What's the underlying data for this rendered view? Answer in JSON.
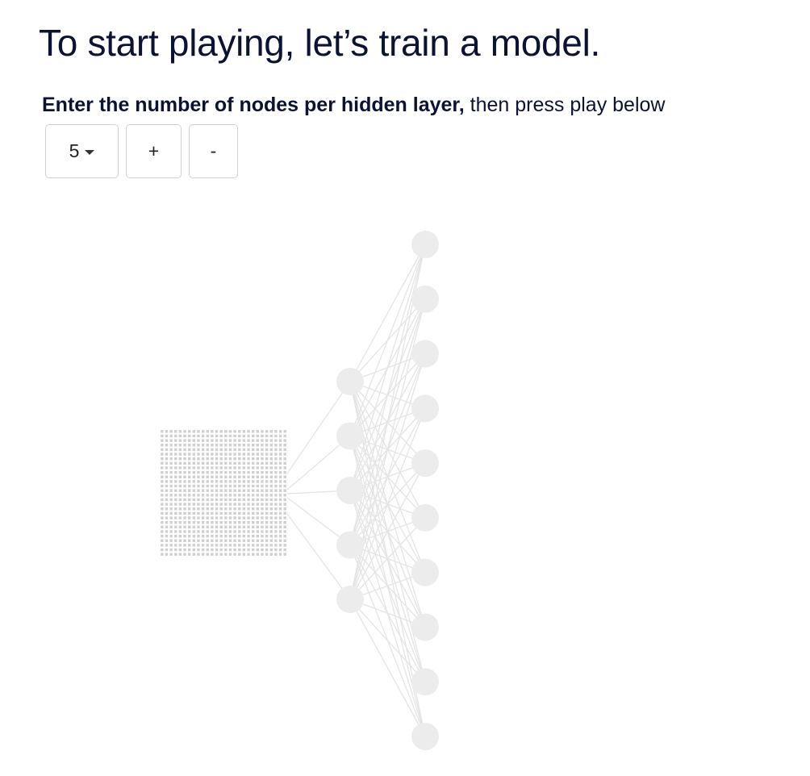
{
  "header": {
    "title": "To start playing, let’s train a model."
  },
  "instruction": {
    "bold_part": "Enter the number of nodes per hidden layer,",
    "normal_part": " then press play below"
  },
  "controls": {
    "nodes_select": {
      "value": "5",
      "icon": "caret-down-icon"
    },
    "add_label": "+",
    "remove_label": "-"
  },
  "network": {
    "input_grid": {
      "rows": 28,
      "cols": 28
    },
    "hidden_layer_nodes": 5,
    "output_layer_nodes": 10,
    "colors": {
      "node": "#ececec",
      "edge": "#e4e4e4",
      "pixel": "#cfcfcf"
    }
  }
}
